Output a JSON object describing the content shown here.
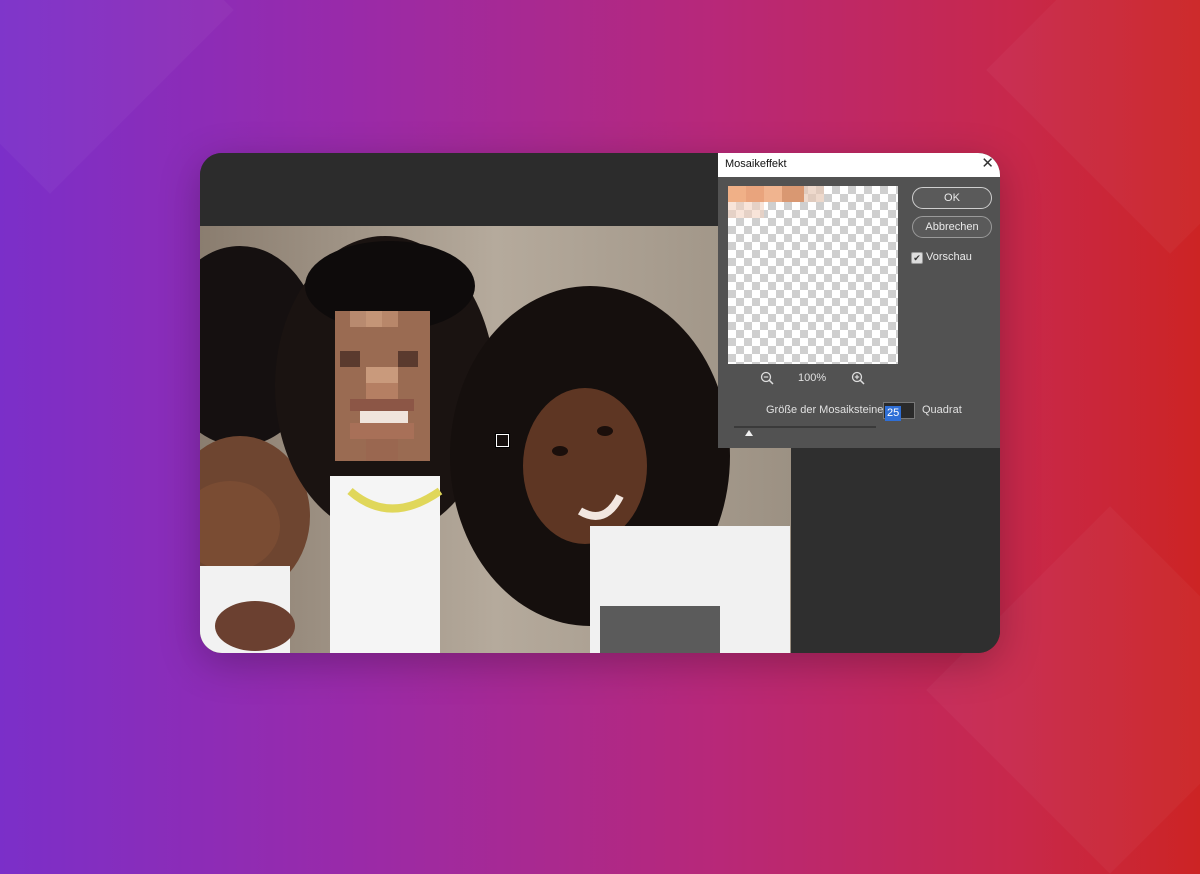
{
  "dialog": {
    "title": "Mosaikeffekt",
    "close_symbol": "✕",
    "ok_label": "OK",
    "cancel_label": "Abbrechen",
    "preview_checkbox": {
      "label": "Vorschau",
      "checked": true
    },
    "zoom_level": "100%",
    "zoom_out_icon": "zoom-out-icon",
    "zoom_in_icon": "zoom-in-icon",
    "cell_size_label": "Größe der Mosaiksteine:",
    "cell_size_value": "25",
    "cell_size_unit": "Quadrat",
    "slider_level": 0.08
  },
  "colors": {
    "background_left": "#7b2fc9",
    "background_right": "#cc2424",
    "dialog_bg": "#525252",
    "input_highlight": "#2f6fd6"
  }
}
